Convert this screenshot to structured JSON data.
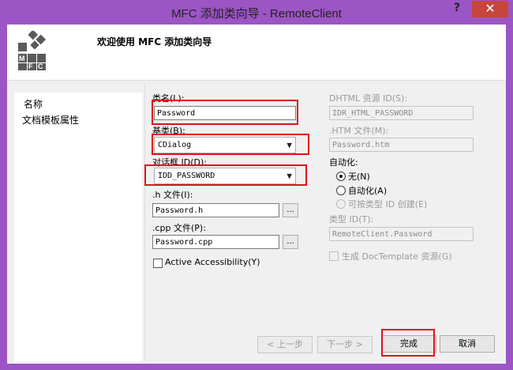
{
  "window": {
    "title": "MFC 添加类向导 - RemoteClient",
    "help_glyph": "?",
    "close_glyph": "✕"
  },
  "header": {
    "title": "欢迎使用 MFC 添加类向导",
    "logo_letters": [
      "M",
      "F",
      "C"
    ]
  },
  "nav": {
    "items": [
      "名称",
      "文档模板属性"
    ]
  },
  "form": {
    "class_name_label": "类名(L):",
    "class_name_value": "Password",
    "base_class_label": "基类(B):",
    "base_class_value": "CDialog",
    "dialog_id_label": "对话框 ID(D):",
    "dialog_id_value": "IDD_PASSWORD",
    "h_file_label": ".h 文件(I):",
    "h_file_value": "Password.h",
    "cpp_file_label": ".cpp 文件(P):",
    "cpp_file_value": "Password.cpp",
    "browse_label": "...",
    "accessibility_label": "Active Accessibility(Y)",
    "dhtml_id_label": "DHTML 资源 ID(S):",
    "dhtml_id_value": "IDR_HTML_PASSWORD",
    "htm_file_label": ".HTM 文件(M):",
    "htm_file_value": "Password.htm",
    "automation_label": "自动化:",
    "automation_options": [
      "无(N)",
      "自动化(A)",
      "可按类型 ID 创建(E)"
    ],
    "type_id_label": "类型 ID(T):",
    "type_id_value": "RemoteClient.Password",
    "doctemplate_label": "生成 DocTemplate 资源(G)"
  },
  "buttons": {
    "prev": "< 上一步",
    "next": "下一步 >",
    "finish": "完成",
    "cancel": "取消"
  },
  "colors": {
    "frame": "#9c55c4",
    "close": "#c7463b",
    "highlight": "#e3101d"
  }
}
